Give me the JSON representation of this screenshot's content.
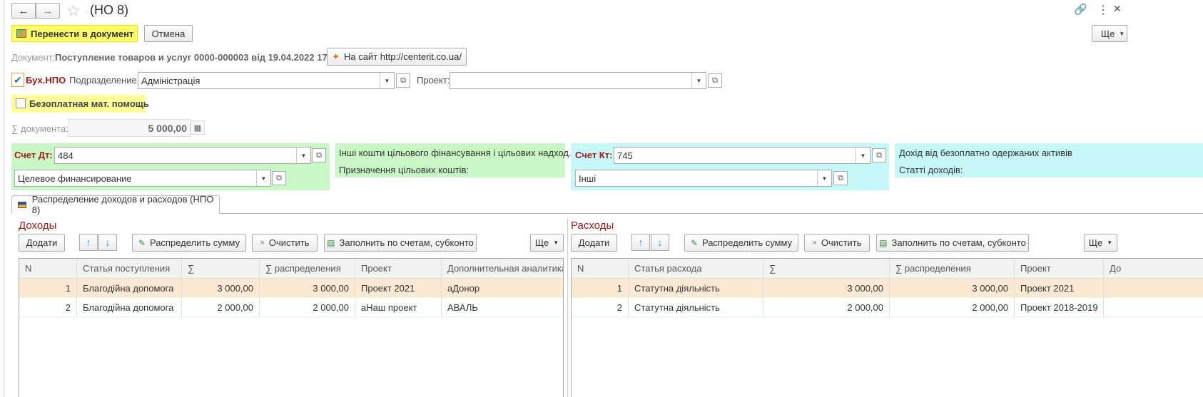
{
  "window": {
    "title": "(НО 8)"
  },
  "toolbar": {
    "transfer_label": "Перенести в документ",
    "cancel_label": "Отмена",
    "more_label": "Ще"
  },
  "document": {
    "label": "Документ:",
    "value": "Поступление товаров и услуг 0000-000003 від 19.04.2022 17:...",
    "site_button": "На сайт http://centerit.co.ua/"
  },
  "npo": {
    "checkbox_label": "Бух.НПО",
    "checked": true,
    "division_label": "Подразделение:",
    "division_value": "Адміністрація",
    "project_label": "Проект:",
    "project_value": ""
  },
  "free_help": {
    "label": "Безоплатная мат. помощь",
    "checked": false
  },
  "sum": {
    "label": "∑ документа:",
    "value": "5 000,00"
  },
  "debit": {
    "label": "Счет Дт:",
    "account": "484",
    "subconto": "Целевое финансирование",
    "desc1": "Інші кошти цільового фінансування і цільових надход...",
    "desc2": "Призначення цільових коштів:"
  },
  "credit": {
    "label": "Счет Кт:",
    "account": "745",
    "subconto": "Інші",
    "desc1": "Дохід від безоплатно одержаних активів",
    "desc2": "Статті доходів:"
  },
  "tab": {
    "label": "Распределение доходов и расходов (НПО 8)"
  },
  "income": {
    "title": "Доходы",
    "buttons": {
      "add": "Додати",
      "distribute": "Распределить сумму",
      "clear": "Очистить",
      "fill": "Заполнить по счетам, субконто",
      "more": "Ще"
    },
    "columns": [
      "N",
      "Статья поступления",
      "∑",
      "∑ распределения",
      "Проект",
      "Дополнительная аналитика"
    ],
    "rows": [
      [
        "1",
        "Благодійна допомога",
        "3 000,00",
        "3 000,00",
        "Проект 2021",
        "аДонор"
      ],
      [
        "2",
        "Благодійна допомога",
        "2 000,00",
        "2 000,00",
        "аНаш проект",
        "АВАЛЬ"
      ]
    ]
  },
  "expense": {
    "title": "Расходы",
    "buttons": {
      "add": "Додати",
      "distribute": "Распределить сумму",
      "clear": "Очистить",
      "fill": "Заполнить по счетам, субконто",
      "more": "Ще"
    },
    "columns": [
      "N",
      "Статья расхода",
      "∑",
      "∑ распределения",
      "Проект",
      "До"
    ],
    "rows": [
      [
        "1",
        "Статутна діяльність",
        "3 000,00",
        "3 000,00",
        "Проект 2021",
        ""
      ],
      [
        "2",
        "Статутна діяльність",
        "2 000,00",
        "2 000,00",
        "Проект 2018-2019",
        ""
      ]
    ]
  },
  "colors": {
    "accent_title": "#a21a1a",
    "highlight_yellow": "#ffff66",
    "green_panel": "#c9f7c6",
    "cyan_panel": "#c6f7f9",
    "selected_row": "#fbe9d4"
  }
}
